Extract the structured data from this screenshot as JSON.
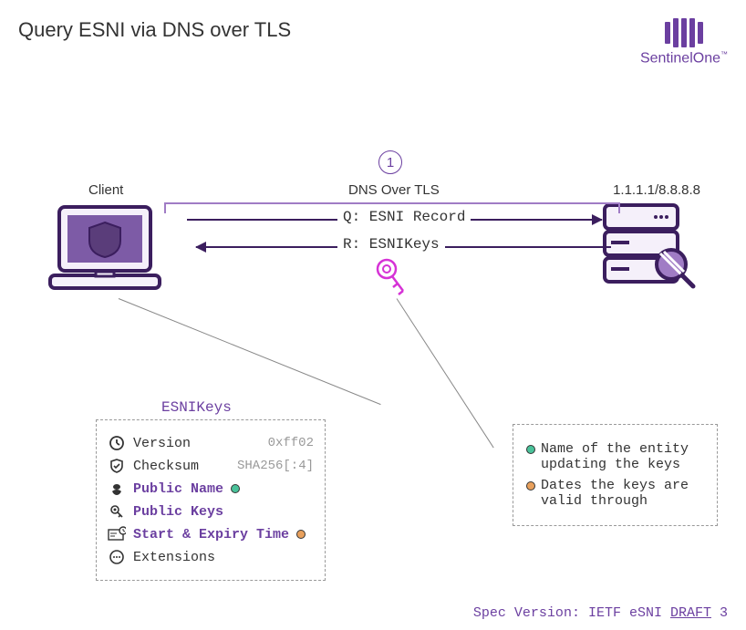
{
  "title": "Query ESNI via DNS over TLS",
  "brand": "SentinelOne",
  "step": "1",
  "client_label": "Client",
  "server_label": "1.1.1.1/8.8.8.8",
  "dns_label": "DNS Over TLS",
  "query_label": "Q: ESNI Record",
  "response_label": "R: ESNIKeys",
  "esnikeys_heading": "ESNIKeys",
  "rows": {
    "version": {
      "label": "Version",
      "value": "0xff02"
    },
    "checksum": {
      "label": "Checksum",
      "value": "SHA256[:4]"
    },
    "public_name": {
      "label": "Public Name"
    },
    "public_keys": {
      "label": "Public Keys"
    },
    "start_expiry": {
      "label": "Start & Expiry Time"
    },
    "extensions": {
      "label": "Extensions"
    }
  },
  "legend": {
    "green": "Name of the entity updating the keys",
    "orange": "Dates the keys are valid through"
  },
  "footer": {
    "prefix": "Spec Version: IETF eSNI ",
    "link": "DRAFT",
    "suffix": " 3"
  }
}
